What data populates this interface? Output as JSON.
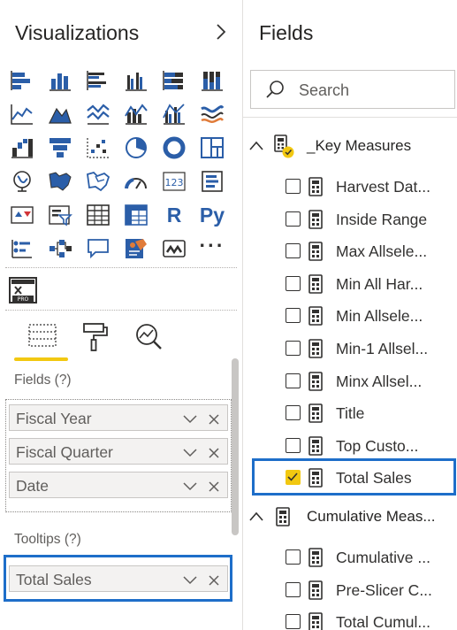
{
  "visualizations": {
    "title": "Visualizations",
    "tab_fields_icon": "fields-tab-icon",
    "tab_format_icon": "paint-roller-icon",
    "tab_analytics_icon": "analytics-magnifier-icon",
    "r_label": "R",
    "py_label": "Py",
    "more_label": "···",
    "fields_section_label": "Fields (?)",
    "fields_wells": [
      {
        "label": "Fiscal Year"
      },
      {
        "label": "Fiscal Quarter"
      },
      {
        "label": "Date"
      }
    ],
    "tooltips_section_label": "Tooltips (?)",
    "tooltips_wells": [
      {
        "label": "Total Sales"
      }
    ]
  },
  "fields": {
    "title": "Fields",
    "search_placeholder": "Search",
    "tables": [
      {
        "name": "_Key Measures",
        "expanded": true,
        "fields": [
          {
            "name": "Harvest Dat...",
            "checked": false
          },
          {
            "name": "Inside Range",
            "checked": false
          },
          {
            "name": "Max Allsele...",
            "checked": false
          },
          {
            "name": "Min All Har...",
            "checked": false
          },
          {
            "name": "Min Allsele...",
            "checked": false
          },
          {
            "name": "Min-1 Allsel...",
            "checked": false
          },
          {
            "name": "Minx Allsel...",
            "checked": false
          },
          {
            "name": "Title",
            "checked": false
          },
          {
            "name": "Top Custo...",
            "checked": false
          },
          {
            "name": "Total Sales",
            "checked": true
          }
        ]
      },
      {
        "name": "Cumulative Meas...",
        "expanded": true,
        "fields": [
          {
            "name": "Cumulative ...",
            "checked": false
          },
          {
            "name": "Pre-Slicer C...",
            "checked": false
          },
          {
            "name": "Total Cumul...",
            "checked": false
          }
        ]
      }
    ]
  },
  "colors": {
    "accent_yellow": "#f2c811",
    "highlight_blue": "#1e6ec9",
    "icon_blue": "#2b5ea8",
    "icon_dark": "#323130"
  }
}
